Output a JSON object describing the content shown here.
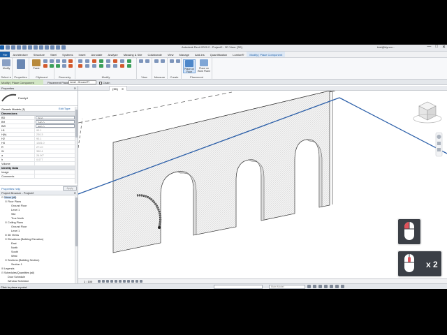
{
  "titlebar": {
    "title": "Autodesk Revit 2020.2 - Project2 - 3D View: {3D}",
    "user": "trial@klynco...",
    "min": "—",
    "max": "□",
    "close": "✕"
  },
  "ribbon_tabs": [
    "File",
    "Architecture",
    "Structure",
    "Steel",
    "Systems",
    "Insert",
    "Annotate",
    "Analyze",
    "Massing & Site",
    "Collaborate",
    "View",
    "Manage",
    "Add-Ins",
    "Quantification",
    "Lumion®",
    "Modify | Place Component"
  ],
  "ribbon": {
    "modify": "Modify",
    "paste": "Paste",
    "copy": "Copy",
    "cut": "Cut",
    "join": "Join",
    "groups": [
      "Select ▾",
      "Properties",
      "Clipboard",
      "Geometry",
      "Modify",
      "View",
      "Measure",
      "Create",
      "Placement"
    ],
    "place_on_face": "Place on Face",
    "place_on_work_plane": "Place on Work Plane"
  },
  "options_bar": {
    "context": "Modify | Place Component",
    "placement_plane_label": "Placement Plane:",
    "placement_plane_value": "Level : Ground Fl",
    "chain_label": "Chain"
  },
  "properties": {
    "header": "Properties",
    "close": "✕",
    "type_name": "Family4",
    "instance_label": "Generic Models (1)",
    "edit_type": "Edit Type",
    "dimensions_section": "Dimensions",
    "rows": [
      {
        "k": "BD",
        "v": "20.0"
      },
      {
        "k": "BH",
        "v": "240.0"
      },
      {
        "k": "BW",
        "v": "500.0"
      },
      {
        "k": "H1",
        "v": "90.1"
      },
      {
        "k": "H(h)",
        "v": "230.3"
      },
      {
        "k": "H2",
        "v": "90.1"
      },
      {
        "k": "H4",
        "v": "1281.0"
      },
      {
        "k": "R",
        "v": "271.0"
      },
      {
        "k": "W",
        "v": "350.4"
      },
      {
        "k": "a",
        "v": "26.00°"
      },
      {
        "k": "h",
        "v": "0.077"
      },
      {
        "k": "Volume",
        "v": ""
      }
    ],
    "identity_section": "Identity Data",
    "identity_rows": [
      {
        "k": "Image",
        "v": ""
      },
      {
        "k": "Comments",
        "v": ""
      }
    ],
    "help_link": "Properties help",
    "apply": "Apply"
  },
  "browser": {
    "header": "Project Browser - Project2",
    "close": "✕",
    "items": [
      {
        "t": "Views (all)",
        "lvl": 0,
        "tg": "⊟",
        "hl": true
      },
      {
        "t": "Floor Plans",
        "lvl": 1,
        "tg": "⊟"
      },
      {
        "t": "Ground Floor",
        "lvl": 2,
        "tg": ""
      },
      {
        "t": "Level 1",
        "lvl": 2,
        "tg": ""
      },
      {
        "t": "Site",
        "lvl": 2,
        "tg": ""
      },
      {
        "t": "True North",
        "lvl": 2,
        "tg": ""
      },
      {
        "t": "Ceiling Plans",
        "lvl": 1,
        "tg": "⊟"
      },
      {
        "t": "Ground Floor",
        "lvl": 2,
        "tg": ""
      },
      {
        "t": "Level 1",
        "lvl": 2,
        "tg": ""
      },
      {
        "t": "3D Views",
        "lvl": 1,
        "tg": "⊞"
      },
      {
        "t": "Elevations (Building Elevation)",
        "lvl": 1,
        "tg": "⊟"
      },
      {
        "t": "East",
        "lvl": 2,
        "tg": ""
      },
      {
        "t": "North",
        "lvl": 2,
        "tg": ""
      },
      {
        "t": "South",
        "lvl": 2,
        "tg": ""
      },
      {
        "t": "West",
        "lvl": 2,
        "tg": ""
      },
      {
        "t": "Sections (Building Section)",
        "lvl": 1,
        "tg": "⊟"
      },
      {
        "t": "Section 1",
        "lvl": 2,
        "tg": ""
      },
      {
        "t": "Legends",
        "lvl": 0,
        "tg": "⊞"
      },
      {
        "t": "Schedules/Quantities (all)",
        "lvl": 0,
        "tg": "⊟"
      },
      {
        "t": "Door Schedule",
        "lvl": 1,
        "tg": ""
      },
      {
        "t": "Window Schedule",
        "lvl": 1,
        "tg": ""
      },
      {
        "t": "Sheets (all)",
        "lvl": 0,
        "tg": "⊞"
      }
    ]
  },
  "view_tab": "{3D}",
  "view_tab_close": "✕",
  "view_scale": "1 : 100",
  "status": {
    "message": "Click to place a point.",
    "main_model": "Main Model"
  },
  "overlay": {
    "multiplier": "x 2"
  },
  "colors": {
    "line_blue": "#2a5ea8",
    "wall_fill": "#f2f2f2",
    "mouse_red": "#e0525a",
    "accent": "#1b5fa8"
  }
}
